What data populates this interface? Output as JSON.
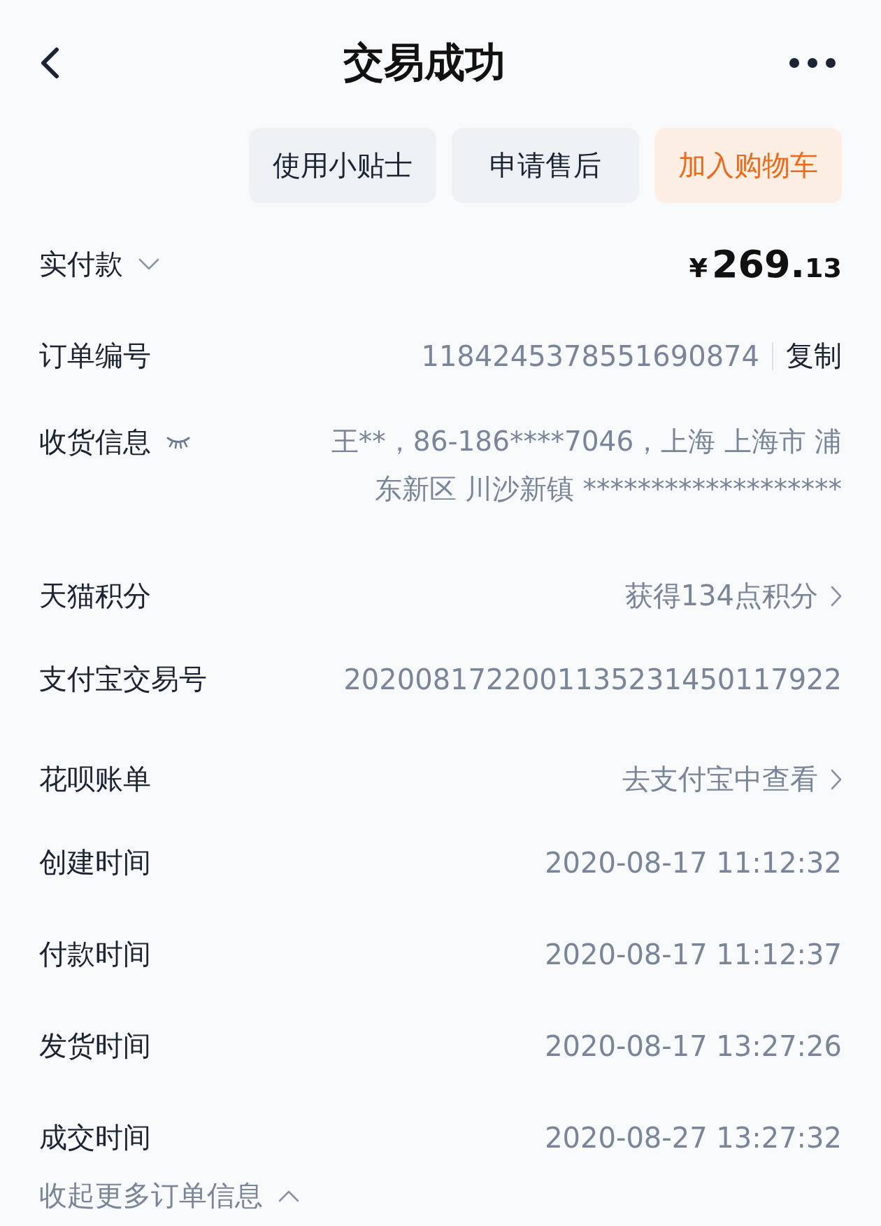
{
  "header": {
    "title": "交易成功"
  },
  "actions": [
    {
      "label": "使用小贴士",
      "kind": "plain"
    },
    {
      "label": "申请售后",
      "kind": "plain"
    },
    {
      "label": "加入购物车",
      "kind": "accent"
    }
  ],
  "rows": [
    {
      "kind": "price",
      "label": "实付款",
      "currency": "¥",
      "amount": "269.",
      "fraction": "13"
    },
    {
      "kind": "copy",
      "label": "订单编号",
      "value": "1184245378551690874",
      "action": "复制"
    },
    {
      "kind": "address",
      "label": "收货信息",
      "lines": [
        "王**，86-186****7046，上海 上海市 浦",
        "东新区 川沙新镇 *******************"
      ]
    },
    {
      "kind": "link",
      "label": "天猫积分",
      "value": "获得134点积分"
    },
    {
      "kind": "plain",
      "label": "支付宝交易号",
      "value": "2020081722001135231450117922"
    },
    {
      "kind": "link",
      "label": "花呗账单",
      "value": "去支付宝中查看"
    },
    {
      "kind": "plain",
      "label": "创建时间",
      "value": "2020-08-17 11:12:32"
    },
    {
      "kind": "plain",
      "label": "付款时间",
      "value": "2020-08-17 11:12:37"
    },
    {
      "kind": "plain",
      "label": "发货时间",
      "value": "2020-08-17 13:27:26"
    },
    {
      "kind": "plain",
      "label": "成交时间",
      "value": "2020-08-27 13:27:32"
    }
  ],
  "collapse": {
    "label": "收起更多订单信息"
  }
}
